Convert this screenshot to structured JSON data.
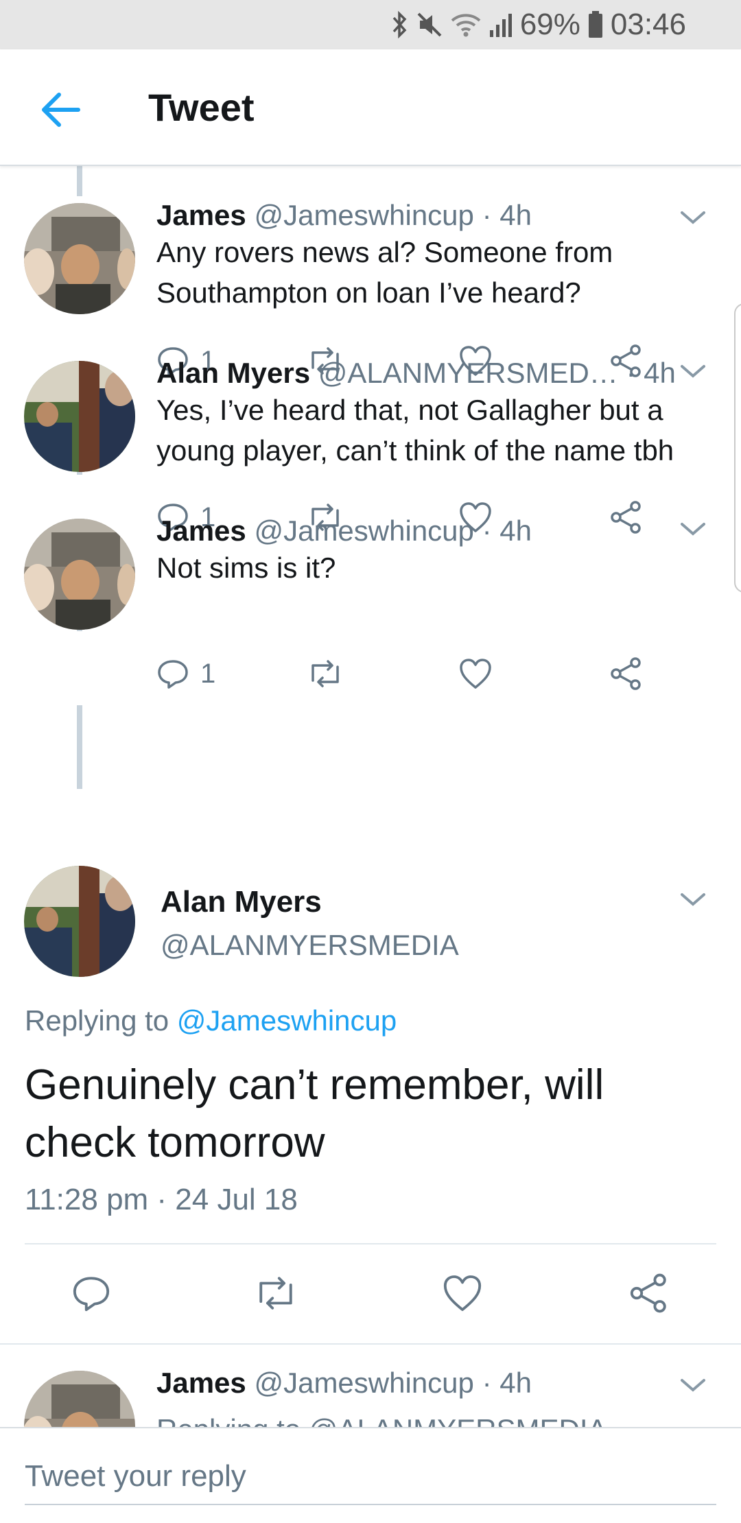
{
  "status_bar": {
    "battery": "69%",
    "time": "03:46"
  },
  "header": {
    "title": "Tweet"
  },
  "thread": [
    {
      "name": "James",
      "handle": "@Jameswhincup",
      "time": "· 4h",
      "lines": [
        "Any rovers news al? Someone from",
        "Southampton on loan I’ve heard?"
      ],
      "reply_count": "1"
    },
    {
      "name": "Alan Myers",
      "handle": "@ALANMYERSMED…",
      "time": "· 4h",
      "lines": [
        "Yes, I’ve heard that, not Gallagher but a",
        "young player, can’t think of the name tbh"
      ],
      "reply_count": "1"
    },
    {
      "name": "James",
      "handle": "@Jameswhincup",
      "time": "· 4h",
      "lines": [
        "Not sims is it?"
      ],
      "reply_count": "1"
    }
  ],
  "main_tweet": {
    "name": "Alan Myers",
    "handle": "@ALANMYERSMEDIA",
    "replying_prefix": "Replying to",
    "replying_to": "@Jameswhincup",
    "lines": [
      "Genuinely can’t remember, will",
      "check tomorrow"
    ],
    "timestamp": "11:28 pm · 24 Jul 18"
  },
  "next_reply": {
    "name": "James",
    "handle": "@Jameswhincup",
    "time": "· 4h",
    "replying_partial": "Replying to @ALANMYERSMEDIA"
  },
  "reply_bar": {
    "placeholder": "Tweet your reply"
  },
  "colors": {
    "accent": "#1da1f2",
    "secondary_text": "#657786",
    "thread_line": "#c8d3dc"
  }
}
